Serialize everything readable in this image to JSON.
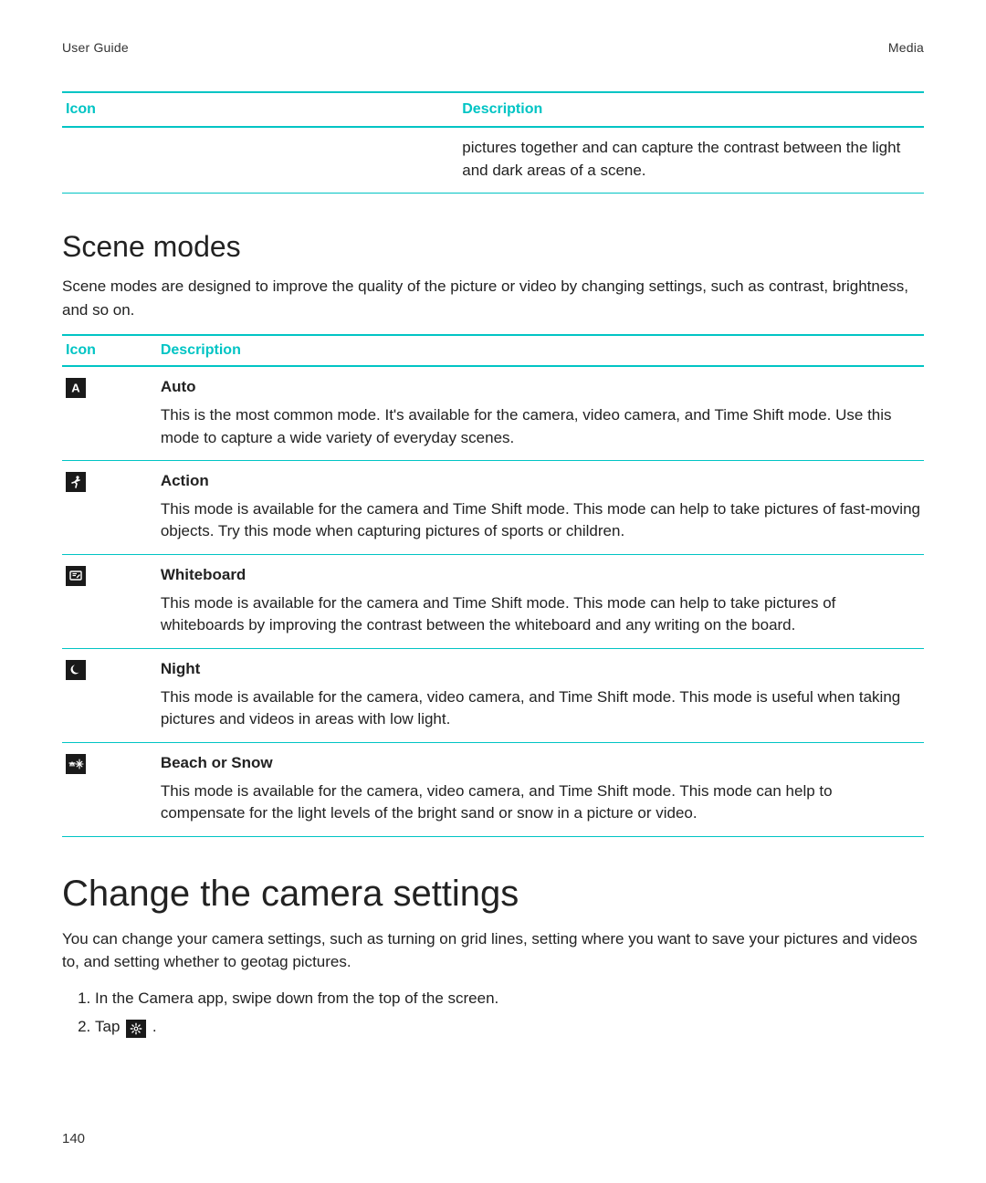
{
  "header": {
    "left": "User Guide",
    "right": "Media"
  },
  "top_table": {
    "headers": {
      "icon": "Icon",
      "description": "Description"
    },
    "row": {
      "desc": "pictures together and can capture the contrast between the light and dark areas of a scene."
    }
  },
  "scene": {
    "heading": "Scene modes",
    "intro": "Scene modes are designed to improve the quality of the picture or video by changing settings, such as contrast, brightness, and so on.",
    "headers": {
      "icon": "Icon",
      "description": "Description"
    },
    "rows": [
      {
        "icon_name": "auto-icon",
        "name": "Auto",
        "desc": "This is the most common mode. It's available for the camera, video camera, and Time Shift mode. Use this mode to capture a wide variety of everyday scenes."
      },
      {
        "icon_name": "action-icon",
        "name": "Action",
        "desc": "This mode is available for the camera and Time Shift mode. This mode can help to take pictures of fast-moving objects. Try this mode when capturing pictures of sports or children."
      },
      {
        "icon_name": "whiteboard-icon",
        "name": "Whiteboard",
        "desc": "This mode is available for the camera and Time Shift mode. This mode can help to take pictures of whiteboards by improving the contrast between the whiteboard and any writing on the board."
      },
      {
        "icon_name": "night-icon",
        "name": "Night",
        "desc": "This mode is available for the camera, video camera, and Time Shift mode. This mode is useful when taking pictures and videos in areas with low light."
      },
      {
        "icon_name": "beach-snow-icon",
        "name": "Beach or Snow",
        "desc": "This mode is available for the camera, video camera, and Time Shift mode. This mode can help to compensate for the light levels of the bright sand or snow in a picture or video."
      }
    ]
  },
  "change": {
    "heading": "Change the camera settings",
    "intro": "You can change your camera settings, such as turning on grid lines, setting where you want to save your pictures and videos to, and setting whether to geotag pictures.",
    "steps": [
      {
        "text": "In the Camera app, swipe down from the top of the screen."
      },
      {
        "text_before": "Tap ",
        "icon": "settings-icon",
        "text_after": " ."
      }
    ]
  },
  "page_number": "140"
}
